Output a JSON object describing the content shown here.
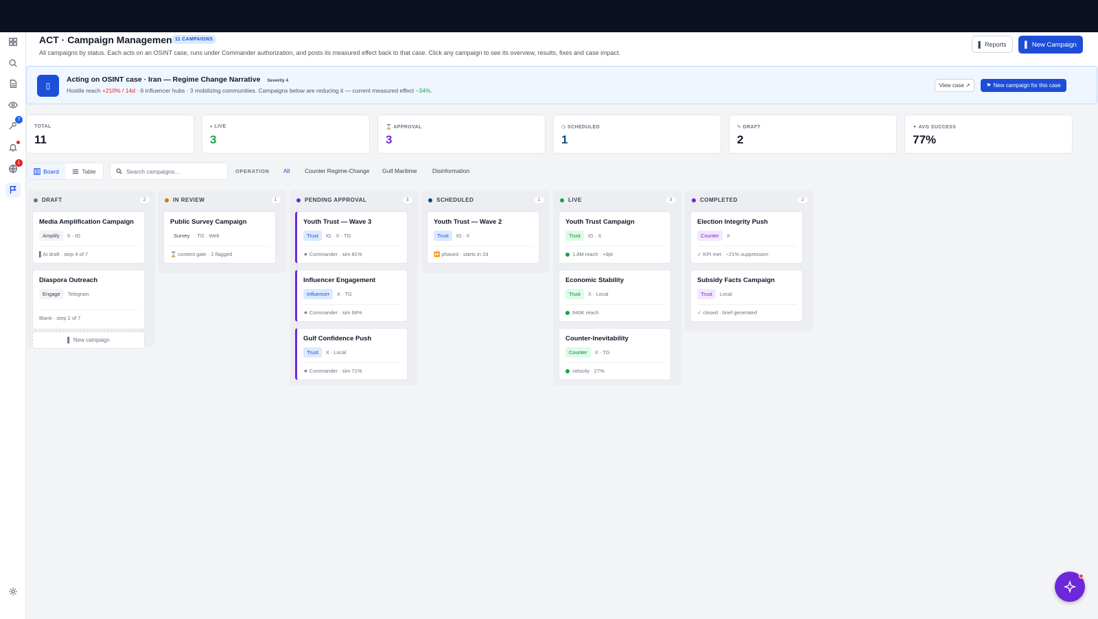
{
  "header": {
    "title": "ACT · Campaign Management",
    "count_badge": "11 CAMPAIGNS",
    "subtitle": "All campaigns by status. Each acts on an OSINT case, runs under Commander authorization, and posts its measured effect back to that case. Click any campaign to see its overview, results, fixes and case impact.",
    "reports_label": "Reports",
    "new_campaign_label": "New Campaign"
  },
  "sidebar": {
    "badges": {
      "targets": "7",
      "globe": "1"
    }
  },
  "case_banner": {
    "title": "Acting on OSINT case · Iran — Regime Change Narrative",
    "severity": "Severity 4",
    "text_prefix": "Hostile reach ",
    "reach": "+210% / 14d",
    "text_middle": " · 6 influencer hubs · 3 mobilizing communities. Campaigns below are reducing it — current measured effect ",
    "effect": "−34%",
    "text_suffix": ".",
    "view_case_label": "View case",
    "new_campaign_case_label": "New campaign for this case"
  },
  "stats": [
    {
      "label": "TOTAL",
      "value": "11",
      "color": "#111827",
      "icon": ""
    },
    {
      "label": "LIVE",
      "value": "3",
      "color": "#16a34a",
      "icon": "●"
    },
    {
      "label": "APPROVAL",
      "value": "3",
      "color": "#6d28d9",
      "icon": "⌛"
    },
    {
      "label": "SCHEDULED",
      "value": "1",
      "color": "#0e4a7a",
      "icon": "◷"
    },
    {
      "label": "DRAFT",
      "value": "2",
      "color": "#111827",
      "icon": "✎"
    },
    {
      "label": "AVG SUCCESS",
      "value": "77%",
      "color": "#111827",
      "icon": "✦"
    }
  ],
  "toolbar": {
    "board_label": "Board",
    "table_label": "Table",
    "search_placeholder": "Search campaigns…",
    "operation_label": "OPERATION",
    "operations": [
      "All",
      "Counter Regime-Change",
      "Gulf Maritime",
      "Disinformation"
    ]
  },
  "columns": [
    {
      "name": "DRAFT",
      "count": "2",
      "color": "#6b7280",
      "cards": [
        {
          "title": "Media Amplification Campaign",
          "tag": "Amplify",
          "tag_style": "gray",
          "channels": "X · IG",
          "foot": "▌AI draft · step 4 of 7",
          "accent": false,
          "dot": false
        },
        {
          "title": "Diaspora Outreach",
          "tag": "Engage",
          "tag_style": "gray",
          "channels": "Telegram",
          "foot": "Blank · step 2 of 7",
          "accent": false,
          "dot": false
        }
      ],
      "add_label": "New campaign"
    },
    {
      "name": "IN REVIEW",
      "count": "1",
      "color": "#d97706",
      "cards": [
        {
          "title": "Public Survey Campaign",
          "tag": "Survey",
          "tag_style": "plain",
          "channels": "TG · Web",
          "foot": "⌛ content gate · 2 flagged",
          "accent": false,
          "dot": false
        }
      ]
    },
    {
      "name": "PENDING APPROVAL",
      "count": "3",
      "color": "#6d28d9",
      "cards": [
        {
          "title": "Youth Trust — Wave 3",
          "tag": "Trust",
          "tag_style": "blue",
          "channels": "IG · X · TG",
          "foot": "★ Commander · sim 81%",
          "accent": true,
          "dot": false
        },
        {
          "title": "Influencer Engagement",
          "tag": "Influencer",
          "tag_style": "blue",
          "channels": "X · TG",
          "foot": "★ Commander · sim 68%",
          "accent": true,
          "dot": false
        },
        {
          "title": "Gulf Confidence Push",
          "tag": "Trust",
          "tag_style": "blue",
          "channels": "X · Local",
          "foot": "★ Commander · sim 71%",
          "accent": true,
          "dot": false
        }
      ]
    },
    {
      "name": "SCHEDULED",
      "count": "1",
      "color": "#0e4a7a",
      "cards": [
        {
          "title": "Youth Trust — Wave 2",
          "tag": "Trust",
          "tag_style": "blue",
          "channels": "IG · X",
          "foot": "⏩ phased · starts in 2d",
          "accent": false,
          "dot": false
        }
      ]
    },
    {
      "name": "LIVE",
      "count": "3",
      "color": "#16a34a",
      "cards": [
        {
          "title": "Youth Trust Campaign",
          "tag": "Trust",
          "tag_style": "green",
          "channels": "IG · X",
          "foot": "1.8M reach · +9pt",
          "accent": false,
          "dot": true
        },
        {
          "title": "Economic Stability",
          "tag": "Trust",
          "tag_style": "green",
          "channels": "X · Local",
          "foot": "940K reach",
          "accent": false,
          "dot": true
        },
        {
          "title": "Counter-Inevitability",
          "tag": "Counter",
          "tag_style": "green",
          "channels": "X · TG",
          "foot": "velocity · 27%",
          "accent": false,
          "dot": true
        }
      ]
    },
    {
      "name": "COMPLETED",
      "count": "2",
      "color": "#7e22ce",
      "cards": [
        {
          "title": "Election Integrity Push",
          "tag": "Counter",
          "tag_style": "purple",
          "channels": "X",
          "foot": "✓ KPI met · −21% suppression",
          "accent": false,
          "dot": false
        },
        {
          "title": "Subsidy Facts Campaign",
          "tag": "Trust",
          "tag_style": "purple",
          "channels": "Local",
          "foot": "✓ closed · brief generated",
          "accent": false,
          "dot": false
        }
      ]
    }
  ]
}
